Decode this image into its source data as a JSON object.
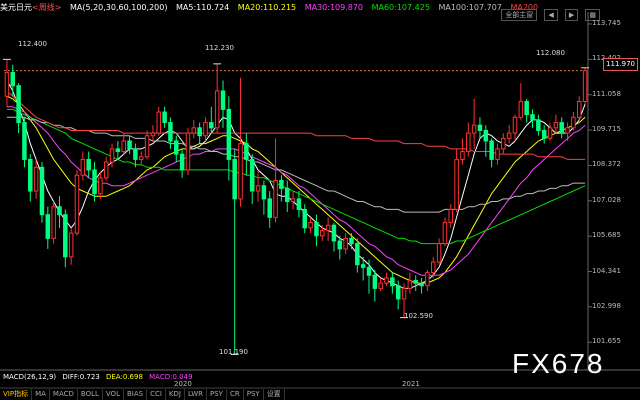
{
  "topbar": {
    "symbol": "美元日元",
    "period": "<周线>",
    "ma_title": "MA(5,20,30,60,100,200)",
    "ma5": "MA5:110.724",
    "ma20": "MA20:110.215",
    "ma30": "MA30:109.870",
    "ma60": "MA60:107.425",
    "ma100": "MA100:107.707",
    "ma200": "MA200",
    "btn_full": "全部主窗",
    "btn_left": "◀",
    "btn_right": "▶",
    "btn_grid": "▦"
  },
  "colors": {
    "up": "#ff3030",
    "down": "#00ff80",
    "ma5": "#ffffff",
    "ma20": "#ffff00",
    "ma30": "#ff40ff",
    "ma60": "#00e000",
    "ma100": "#bbbbbb",
    "ma200": "#ff4040",
    "bg": "#000000"
  },
  "price_tag": "111.970",
  "annotations": {
    "high1": "112.400",
    "high2": "112.230",
    "high3": "112.080",
    "low1": "101.190",
    "low2": "102.590"
  },
  "macd": {
    "title": "MACD(26,12,9)",
    "diff": "DIFF:0.723",
    "dea": "DEA:0.698",
    "macd": "MACD:0.049"
  },
  "x_labels": [
    "2020",
    "2021"
  ],
  "tabs": [
    "VIP指标",
    "MA",
    "MACD",
    "BOLL",
    "VOL",
    "BIAS",
    "CCI",
    "KDJ",
    "LWR",
    "PSY",
    "CR",
    "PSY",
    "设置"
  ],
  "watermark": "FX678",
  "chart_data": {
    "type": "candlestick",
    "title": "美元日元 <周线>",
    "y_ticks": [
      113.745,
      112.402,
      111.058,
      109.715,
      108.372,
      107.028,
      105.685,
      104.341,
      102.998,
      101.655
    ],
    "ylim": [
      100.6,
      114.2
    ],
    "x_labels": [
      "2020",
      "2021"
    ],
    "candles": [
      [
        111.0,
        111.9,
        110.6,
        112.4
      ],
      [
        111.9,
        111.4,
        111.0,
        112.2
      ],
      [
        111.4,
        110.0,
        109.6,
        111.5
      ],
      [
        110.0,
        108.6,
        108.3,
        110.2
      ],
      [
        108.6,
        107.4,
        107.0,
        108.8
      ],
      [
        107.4,
        108.3,
        107.1,
        108.6
      ],
      [
        108.3,
        106.5,
        106.2,
        108.5
      ],
      [
        106.5,
        105.6,
        105.2,
        106.8
      ],
      [
        105.6,
        106.8,
        105.4,
        107.0
      ],
      [
        106.8,
        106.5,
        106.0,
        107.2
      ],
      [
        106.5,
        104.9,
        104.5,
        106.7
      ],
      [
        104.9,
        105.8,
        104.6,
        106.0
      ],
      [
        105.8,
        108.0,
        105.7,
        108.2
      ],
      [
        108.0,
        108.6,
        107.8,
        108.9
      ],
      [
        108.6,
        108.2,
        107.9,
        108.9
      ],
      [
        108.2,
        107.3,
        107.0,
        108.5
      ],
      [
        107.3,
        107.9,
        107.1,
        108.1
      ],
      [
        107.9,
        108.5,
        107.8,
        108.7
      ],
      [
        108.5,
        109.0,
        108.3,
        109.2
      ],
      [
        109.0,
        108.9,
        108.6,
        109.3
      ],
      [
        108.9,
        109.3,
        108.8,
        109.6
      ],
      [
        109.3,
        109.0,
        108.8,
        109.5
      ],
      [
        109.0,
        108.6,
        108.3,
        109.2
      ],
      [
        108.6,
        108.7,
        108.4,
        108.9
      ],
      [
        108.7,
        109.5,
        108.6,
        109.7
      ],
      [
        109.5,
        109.6,
        109.3,
        109.9
      ],
      [
        109.6,
        110.4,
        109.5,
        110.6
      ],
      [
        110.4,
        110.0,
        109.8,
        110.6
      ],
      [
        110.0,
        109.3,
        109.0,
        110.2
      ],
      [
        109.3,
        108.8,
        108.5,
        109.5
      ],
      [
        108.8,
        108.2,
        107.9,
        109.0
      ],
      [
        108.2,
        109.6,
        108.0,
        109.8
      ],
      [
        109.6,
        109.8,
        109.4,
        110.1
      ],
      [
        109.8,
        109.5,
        109.2,
        110.0
      ],
      [
        109.5,
        110.0,
        109.3,
        110.2
      ],
      [
        110.0,
        109.8,
        109.6,
        110.6
      ],
      [
        109.8,
        111.2,
        109.6,
        112.23
      ],
      [
        111.2,
        110.5,
        109.8,
        111.6
      ],
      [
        110.5,
        108.6,
        107.8,
        111.0
      ],
      [
        108.6,
        107.1,
        101.19,
        109.0
      ],
      [
        107.1,
        109.2,
        106.8,
        111.7
      ],
      [
        109.2,
        108.6,
        108.0,
        109.6
      ],
      [
        108.6,
        107.4,
        106.9,
        108.8
      ],
      [
        107.4,
        107.6,
        107.0,
        108.2
      ],
      [
        107.6,
        107.1,
        106.5,
        107.8
      ],
      [
        107.1,
        106.4,
        106.0,
        107.4
      ],
      [
        106.4,
        107.8,
        106.2,
        109.4
      ],
      [
        107.8,
        107.5,
        107.0,
        108.0
      ],
      [
        107.5,
        107.0,
        106.6,
        107.8
      ],
      [
        107.0,
        107.1,
        106.7,
        107.4
      ],
      [
        107.1,
        106.7,
        106.4,
        107.4
      ],
      [
        106.7,
        106.0,
        105.8,
        106.9
      ],
      [
        106.0,
        106.2,
        105.8,
        106.4
      ],
      [
        106.2,
        105.7,
        105.3,
        106.5
      ],
      [
        105.7,
        105.9,
        105.5,
        106.1
      ],
      [
        105.9,
        106.1,
        105.5,
        106.4
      ],
      [
        106.1,
        105.5,
        105.1,
        106.2
      ],
      [
        105.5,
        105.2,
        104.8,
        105.7
      ],
      [
        105.2,
        105.6,
        105.0,
        105.8
      ],
      [
        105.6,
        105.4,
        105.2,
        105.8
      ],
      [
        105.4,
        104.6,
        104.3,
        105.6
      ],
      [
        104.6,
        104.5,
        104.0,
        104.9
      ],
      [
        104.5,
        104.2,
        103.5,
        104.8
      ],
      [
        104.2,
        103.7,
        103.2,
        104.4
      ],
      [
        103.7,
        103.9,
        103.6,
        104.1
      ],
      [
        103.9,
        104.1,
        103.8,
        104.3
      ],
      [
        104.1,
        103.8,
        103.5,
        104.3
      ],
      [
        103.8,
        103.3,
        102.9,
        104.0
      ],
      [
        103.3,
        103.7,
        102.59,
        103.9
      ],
      [
        103.7,
        104.0,
        103.5,
        104.3
      ],
      [
        104.0,
        103.9,
        103.6,
        104.2
      ],
      [
        103.9,
        103.8,
        103.5,
        104.1
      ],
      [
        103.8,
        104.3,
        103.6,
        104.4
      ],
      [
        104.3,
        104.7,
        104.1,
        104.9
      ],
      [
        104.7,
        105.4,
        104.6,
        105.6
      ],
      [
        105.4,
        106.2,
        105.3,
        106.4
      ],
      [
        106.2,
        106.7,
        106.0,
        106.9
      ],
      [
        106.7,
        108.6,
        106.6,
        109.0
      ],
      [
        108.6,
        108.9,
        108.4,
        109.4
      ],
      [
        108.9,
        109.6,
        108.7,
        110.0
      ],
      [
        109.6,
        109.9,
        109.0,
        110.9
      ],
      [
        109.9,
        109.7,
        109.4,
        110.2
      ],
      [
        109.7,
        109.3,
        108.7,
        109.9
      ],
      [
        109.3,
        108.6,
        108.3,
        109.4
      ],
      [
        108.6,
        109.0,
        108.4,
        109.2
      ],
      [
        109.0,
        109.4,
        108.8,
        109.6
      ],
      [
        109.4,
        109.6,
        109.2,
        109.9
      ],
      [
        109.6,
        110.2,
        109.3,
        110.3
      ],
      [
        110.2,
        110.8,
        110.1,
        111.5
      ],
      [
        110.8,
        110.3,
        110.0,
        110.9
      ],
      [
        110.3,
        110.1,
        109.8,
        110.5
      ],
      [
        110.1,
        109.7,
        109.5,
        110.3
      ],
      [
        109.7,
        109.4,
        109.2,
        109.9
      ],
      [
        109.4,
        109.8,
        109.3,
        110.0
      ],
      [
        109.8,
        110.0,
        109.6,
        110.3
      ],
      [
        110.0,
        109.6,
        109.4,
        110.2
      ],
      [
        109.6,
        109.8,
        109.3,
        110.0
      ],
      [
        109.8,
        110.2,
        109.7,
        110.4
      ],
      [
        110.2,
        110.8,
        110.0,
        111.0
      ],
      [
        110.8,
        111.97,
        110.7,
        112.08
      ]
    ],
    "moving_averages": [
      {
        "name": "MA5",
        "values": [
          111.6,
          111.2,
          110.6,
          110.0,
          109.2,
          108.6,
          108.0,
          107.4,
          107.0,
          106.6,
          106.3,
          106.0,
          106.3,
          106.8,
          107.4,
          107.8,
          108.1,
          108.3,
          108.5,
          108.6,
          108.8,
          109.0,
          109.0,
          109.0,
          109.1,
          109.2,
          109.4,
          109.6,
          109.7,
          109.6,
          109.3,
          109.0,
          109.0,
          109.1,
          109.3,
          109.6,
          109.9,
          110.2,
          110.1,
          109.6,
          109.4,
          109.0,
          108.6,
          108.2,
          108.0,
          107.8,
          107.3,
          107.2,
          107.2,
          107.0,
          106.8,
          106.6,
          106.4,
          106.2,
          106.0,
          105.9,
          105.8,
          105.6,
          105.5,
          105.3,
          105.0,
          104.8,
          104.6,
          104.3,
          104.1,
          104.0,
          103.9,
          103.8,
          103.7,
          103.7,
          103.8,
          103.9,
          104.0,
          104.2,
          104.5,
          105.0,
          105.6,
          106.4,
          107.2,
          108.0,
          108.8,
          109.4,
          109.6,
          109.5,
          109.3,
          109.2,
          109.1,
          109.3,
          109.6,
          109.9,
          110.1,
          110.1,
          110.0,
          109.8,
          109.6,
          109.6,
          109.6,
          109.8,
          110.1,
          110.7
        ]
      },
      {
        "name": "MA20",
        "values": [
          111.0,
          110.9,
          110.7,
          110.4,
          110.1,
          109.8,
          109.4,
          109.0,
          108.6,
          108.3,
          108.0,
          107.7,
          107.5,
          107.4,
          107.3,
          107.2,
          107.2,
          107.2,
          107.3,
          107.4,
          107.5,
          107.6,
          107.8,
          108.0,
          108.2,
          108.3,
          108.5,
          108.7,
          108.8,
          108.9,
          109.0,
          109.0,
          109.1,
          109.2,
          109.2,
          109.3,
          109.4,
          109.5,
          109.5,
          109.4,
          109.3,
          109.2,
          109.0,
          108.9,
          108.7,
          108.5,
          108.3,
          108.1,
          107.9,
          107.7,
          107.5,
          107.3,
          107.1,
          106.9,
          106.7,
          106.5,
          106.3,
          106.1,
          105.9,
          105.7,
          105.5,
          105.3,
          105.1,
          104.9,
          104.7,
          104.5,
          104.3,
          104.2,
          104.1,
          104.0,
          103.9,
          103.9,
          103.9,
          104.0,
          104.1,
          104.3,
          104.6,
          104.9,
          105.3,
          105.7,
          106.1,
          106.5,
          106.9,
          107.3,
          107.6,
          107.9,
          108.2,
          108.5,
          108.7,
          108.9,
          109.1,
          109.3,
          109.4,
          109.5,
          109.6,
          109.7,
          109.8,
          109.9,
          110.0,
          110.2
        ]
      },
      {
        "name": "MA30",
        "values": [
          110.6,
          110.6,
          110.5,
          110.4,
          110.2,
          110.0,
          109.8,
          109.6,
          109.3,
          109.0,
          108.8,
          108.5,
          108.3,
          108.1,
          107.9,
          107.8,
          107.7,
          107.7,
          107.6,
          107.6,
          107.6,
          107.7,
          107.8,
          107.9,
          108.0,
          108.1,
          108.2,
          108.3,
          108.4,
          108.5,
          108.6,
          108.7,
          108.8,
          108.8,
          108.9,
          108.9,
          109.0,
          109.0,
          109.0,
          109.0,
          108.9,
          108.8,
          108.7,
          108.6,
          108.5,
          108.4,
          108.3,
          108.1,
          108.0,
          107.8,
          107.6,
          107.5,
          107.3,
          107.1,
          106.9,
          106.7,
          106.5,
          106.3,
          106.2,
          106.0,
          105.8,
          105.6,
          105.4,
          105.3,
          105.1,
          104.9,
          104.8,
          104.6,
          104.5,
          104.4,
          104.3,
          104.2,
          104.2,
          104.2,
          104.2,
          104.3,
          104.4,
          104.6,
          104.8,
          105.0,
          105.3,
          105.6,
          105.9,
          106.2,
          106.5,
          106.8,
          107.1,
          107.4,
          107.7,
          107.9,
          108.2,
          108.4,
          108.6,
          108.8,
          109.0,
          109.2,
          109.4,
          109.6,
          109.7,
          109.9
        ]
      },
      {
        "name": "MA60",
        "values": [
          110.5,
          110.5,
          110.4,
          110.3,
          110.2,
          110.1,
          110.0,
          109.9,
          109.8,
          109.7,
          109.6,
          109.4,
          109.3,
          109.2,
          109.1,
          109.0,
          108.9,
          108.8,
          108.7,
          108.6,
          108.5,
          108.5,
          108.4,
          108.4,
          108.3,
          108.3,
          108.3,
          108.2,
          108.2,
          108.2,
          108.2,
          108.2,
          108.2,
          108.2,
          108.2,
          108.2,
          108.2,
          108.2,
          108.2,
          108.1,
          108.1,
          108.0,
          108.0,
          107.9,
          107.9,
          107.8,
          107.7,
          107.6,
          107.5,
          107.4,
          107.3,
          107.2,
          107.1,
          107.0,
          106.9,
          106.8,
          106.7,
          106.6,
          106.5,
          106.4,
          106.3,
          106.2,
          106.1,
          106.0,
          105.9,
          105.8,
          105.7,
          105.6,
          105.6,
          105.5,
          105.5,
          105.4,
          105.4,
          105.4,
          105.4,
          105.4,
          105.4,
          105.5,
          105.5,
          105.6,
          105.7,
          105.8,
          105.9,
          106.0,
          106.1,
          106.2,
          106.3,
          106.4,
          106.5,
          106.6,
          106.7,
          106.8,
          106.9,
          107.0,
          107.1,
          107.2,
          107.3,
          107.4,
          107.5,
          107.6
        ]
      },
      {
        "name": "MA100",
        "values": [
          110.2,
          110.2,
          110.2,
          110.2,
          110.1,
          110.1,
          110.0,
          110.0,
          109.9,
          109.9,
          109.8,
          109.8,
          109.7,
          109.7,
          109.7,
          109.6,
          109.6,
          109.6,
          109.5,
          109.5,
          109.5,
          109.5,
          109.4,
          109.4,
          109.4,
          109.3,
          109.3,
          109.3,
          109.2,
          109.2,
          109.2,
          109.1,
          109.1,
          109.0,
          109.0,
          108.9,
          108.9,
          108.8,
          108.8,
          108.7,
          108.7,
          108.6,
          108.5,
          108.5,
          108.4,
          108.3,
          108.2,
          108.2,
          108.1,
          108.0,
          107.9,
          107.8,
          107.7,
          107.6,
          107.5,
          107.4,
          107.4,
          107.3,
          107.2,
          107.1,
          107.0,
          107.0,
          106.9,
          106.8,
          106.8,
          106.7,
          106.7,
          106.7,
          106.6,
          106.6,
          106.6,
          106.6,
          106.6,
          106.6,
          106.6,
          106.7,
          106.7,
          106.7,
          106.7,
          106.8,
          106.8,
          106.9,
          106.9,
          107.0,
          107.0,
          107.1,
          107.1,
          107.2,
          107.2,
          107.3,
          107.3,
          107.4,
          107.4,
          107.5,
          107.5,
          107.6,
          107.6,
          107.7,
          107.7,
          107.7
        ]
      },
      {
        "name": "MA200",
        "values": [
          111.2,
          111.0,
          110.8,
          110.6,
          110.4,
          110.2,
          110.1,
          110.0,
          109.9,
          109.8,
          109.8,
          109.7,
          109.7,
          109.7,
          109.7,
          109.7,
          109.7,
          109.7,
          109.7,
          109.7,
          109.6,
          109.6,
          109.6,
          109.6,
          109.6,
          109.6,
          109.6,
          109.6,
          109.6,
          109.6,
          109.6,
          109.6,
          109.6,
          109.6,
          109.6,
          109.6,
          109.6,
          109.6,
          109.6,
          109.6,
          109.6,
          109.6,
          109.6,
          109.6,
          109.6,
          109.6,
          109.6,
          109.6,
          109.6,
          109.6,
          109.6,
          109.6,
          109.6,
          109.5,
          109.5,
          109.5,
          109.5,
          109.5,
          109.5,
          109.4,
          109.4,
          109.4,
          109.4,
          109.3,
          109.3,
          109.3,
          109.3,
          109.3,
          109.2,
          109.2,
          109.2,
          109.2,
          109.1,
          109.1,
          109.1,
          109.1,
          109.0,
          109.0,
          109.0,
          109.0,
          108.9,
          108.9,
          108.9,
          108.9,
          108.8,
          108.8,
          108.8,
          108.8,
          108.8,
          108.8,
          108.8,
          108.7,
          108.7,
          108.7,
          108.7,
          108.7,
          108.6,
          108.6,
          108.6,
          108.6
        ]
      }
    ]
  }
}
